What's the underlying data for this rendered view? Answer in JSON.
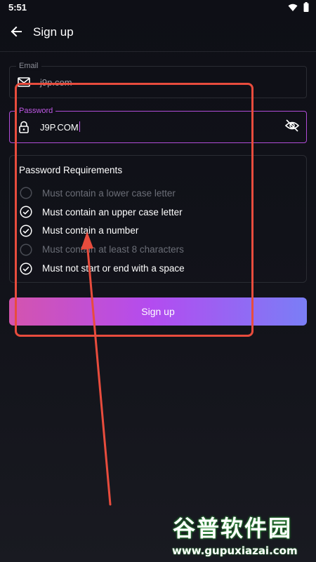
{
  "status_bar": {
    "time": "5:51",
    "icons": [
      "wifi-icon",
      "battery-icon"
    ]
  },
  "app_bar": {
    "title": "Sign up",
    "back_icon": "arrow-left-icon"
  },
  "form": {
    "email": {
      "label": "Email",
      "value": "j9p.com",
      "icon": "mail-icon"
    },
    "password": {
      "label": "Password",
      "value": "J9P.COM",
      "icon": "lock-icon",
      "toggle_icon": "eye-off-icon",
      "focused": true
    }
  },
  "requirements": {
    "title": "Password Requirements",
    "items": [
      {
        "label": "Must contain a lower case letter",
        "met": false
      },
      {
        "label": "Must contain an upper case letter",
        "met": true
      },
      {
        "label": "Must contain a number",
        "met": true
      },
      {
        "label": "Must contain at least 8 characters",
        "met": false
      },
      {
        "label": "Must not start or end with a space",
        "met": true
      }
    ]
  },
  "signup_button": {
    "label": "Sign up"
  },
  "watermark": {
    "cn": "谷普软件园",
    "en": "www.gupuxiazai.com"
  },
  "colors": {
    "background": "#0e0f16",
    "focus_accent": "#c058e6",
    "annotation": "#e84c3d",
    "button_gradient": [
      "#d454ae",
      "#b34cf0",
      "#7a7ef6"
    ]
  }
}
